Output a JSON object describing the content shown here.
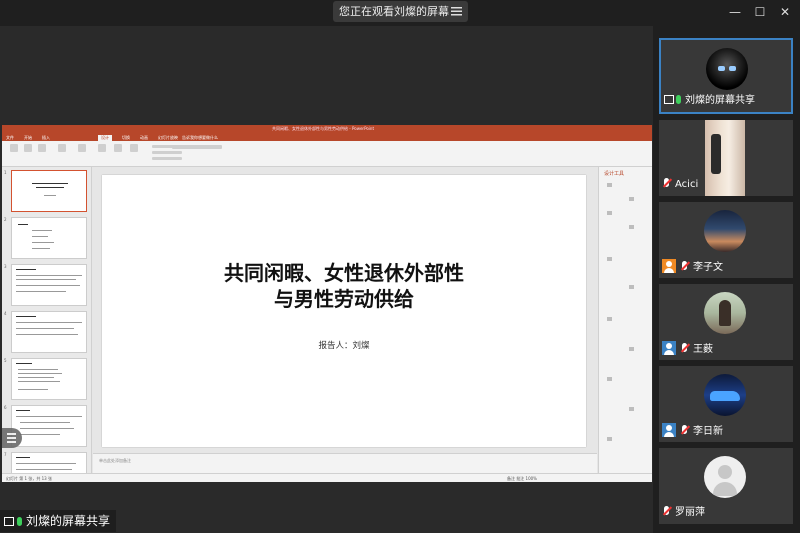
{
  "banner": {
    "text": "您正在观看刘燦的屏幕"
  },
  "window_controls": {
    "minimize": "—",
    "maximize": "☐",
    "close": "✕"
  },
  "ppt": {
    "title_bar": "共同闲暇、女性退休外部性与男性劳动供给 - PowerPoint",
    "tabs": [
      "文件",
      "开始",
      "插入",
      "设计",
      "切换",
      "动画",
      "幻灯片放映",
      "审阅",
      "视图",
      "帮助",
      "告诉我你想要做什么"
    ],
    "active_tab": "设计",
    "slide": {
      "title_line1": "共同闲暇、女性退休外部性",
      "title_line2": "与男性劳动供给",
      "subtitle": "报告人：刘燦"
    },
    "notes_placeholder": "单击此处添加备注",
    "design_pane_title": "设计工具",
    "status_left": "幻灯片 第 1 张，共 13 张",
    "status_right": "备注   批注   100%"
  },
  "bottom_label": {
    "text": "刘燦的屏幕共享"
  },
  "participants": [
    {
      "name": "刘燦的屏幕共享",
      "avatar": "vader",
      "mic": "on",
      "sharing": true,
      "speaking": true
    },
    {
      "name": "Acici",
      "avatar": "photo",
      "mic": "off"
    },
    {
      "name": "李子文",
      "avatar": "sunset",
      "mic": "off",
      "badge": "orange"
    },
    {
      "name": "王薮",
      "avatar": "girl",
      "mic": "off",
      "badge": "blue"
    },
    {
      "name": "李日新",
      "avatar": "car",
      "mic": "off",
      "badge": "blue"
    },
    {
      "name": "罗丽萍",
      "avatar": "default",
      "mic": "off"
    }
  ]
}
